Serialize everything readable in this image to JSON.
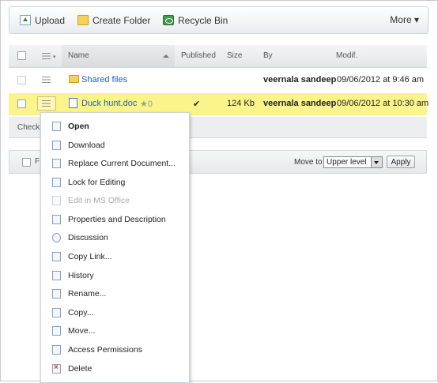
{
  "toolbar": {
    "upload_label": "Upload",
    "create_folder_label": "Create Folder",
    "recycle_bin_label": "Recycle Bin",
    "more_label": "More ▾"
  },
  "table": {
    "headers": {
      "name": "Name",
      "published": "Published",
      "size": "Size",
      "by": "By",
      "modified": "Modif."
    },
    "rows": [
      {
        "name": "Shared files",
        "published": "",
        "size": "",
        "by": "veernala sandeep",
        "modified": "09/06/2012 at 9:46 am"
      },
      {
        "name": "Duck hunt.doc",
        "rating": "★0",
        "published": "✔",
        "size": "124 Kb",
        "by": "veernala sandeep",
        "modified": "09/06/2012 at 10:30 am"
      }
    ]
  },
  "under_bar": {
    "label": "Check"
  },
  "bottom_bar": {
    "label": "F",
    "move_to_label": "Move to",
    "move_to_value": "Upper level",
    "apply_label": "Apply"
  },
  "context_menu": [
    {
      "label": "Open",
      "icon": "open-doc-icon"
    },
    {
      "label": "Download",
      "icon": "download-icon"
    },
    {
      "label": "Replace Current Document...",
      "icon": "replace-doc-icon"
    },
    {
      "label": "Lock for Editing",
      "icon": "lock-icon"
    },
    {
      "label": "Edit in MS Office",
      "icon": "edit-office-icon"
    },
    {
      "label": "Properties and Description",
      "icon": "properties-icon"
    },
    {
      "label": "Discussion",
      "icon": "discussion-icon"
    },
    {
      "label": "Copy Link...",
      "icon": "copy-link-icon"
    },
    {
      "label": "History",
      "icon": "history-icon"
    },
    {
      "label": "Rename...",
      "icon": "rename-icon"
    },
    {
      "label": "Copy...",
      "icon": "copy-icon"
    },
    {
      "label": "Move...",
      "icon": "move-icon"
    },
    {
      "label": "Access Permissions",
      "icon": "permissions-icon"
    },
    {
      "label": "Delete",
      "icon": "delete-icon"
    }
  ]
}
